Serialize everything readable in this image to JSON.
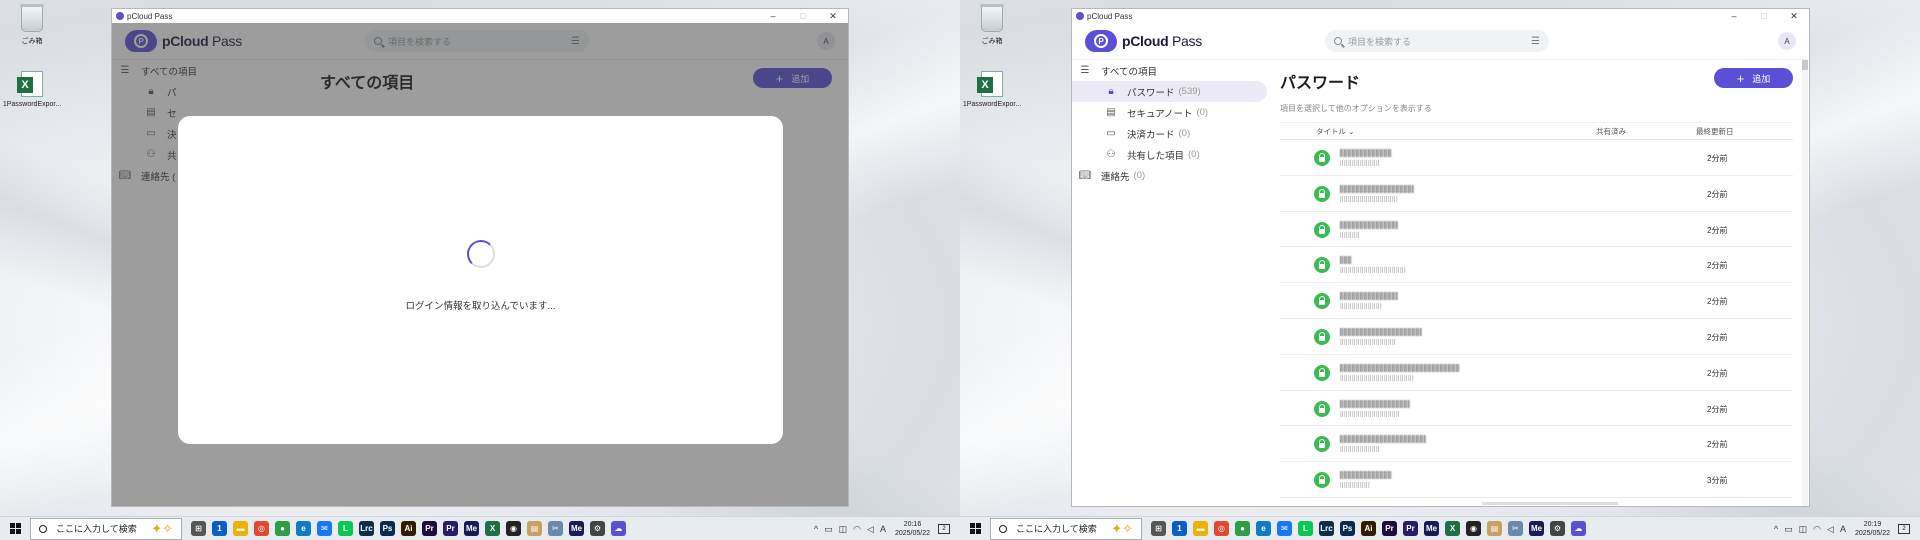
{
  "desktop": {
    "icons": [
      {
        "label": "ごみ箱",
        "icon": "recycle-bin-icon"
      },
      {
        "label": "1PasswordExpor...",
        "icon": "excel-file-icon"
      }
    ]
  },
  "window": {
    "title": "pCloud Pass",
    "controls": {
      "minimize": "–",
      "maximize": "□",
      "close": "✕"
    }
  },
  "app": {
    "logo_bold": "pCloud",
    "logo_light": " Pass",
    "search_placeholder": "項目を検索する",
    "avatar_initial": "A"
  },
  "left_screen": {
    "sidebar": [
      {
        "label": "すべての項目",
        "icon": "list-icon",
        "level": "top"
      },
      {
        "label": "パ",
        "icon": "lock-icon",
        "level": "sub"
      },
      {
        "label": "セ",
        "icon": "note-icon",
        "level": "sub"
      },
      {
        "label": "決",
        "icon": "card-icon",
        "level": "sub"
      },
      {
        "label": "共",
        "icon": "shared-icon",
        "level": "sub"
      },
      {
        "label": "連絡先 (",
        "icon": "book-icon",
        "level": "top"
      }
    ],
    "page_title": "すべての項目",
    "add_label": "追加",
    "loading_text": "ログイン情報を取り込んでいます..."
  },
  "right_screen": {
    "sidebar": [
      {
        "label": "すべての項目",
        "count": "",
        "icon": "list-icon",
        "level": "top"
      },
      {
        "label": "パスワード",
        "count": "(539)",
        "icon": "lock-icon",
        "level": "sub",
        "active": true
      },
      {
        "label": "セキュアノート",
        "count": "(0)",
        "icon": "note-icon",
        "level": "sub"
      },
      {
        "label": "決済カード",
        "count": "(0)",
        "icon": "card-icon",
        "level": "sub"
      },
      {
        "label": "共有した項目",
        "count": "(0)",
        "icon": "shared-icon",
        "level": "sub"
      },
      {
        "label": "連絡先",
        "count": "(0)",
        "icon": "book-icon",
        "level": "top"
      }
    ],
    "page_title": "パスワード",
    "add_label": "追加",
    "hint": "項目を選択して他のオプションを表示する",
    "columns": {
      "title": "タイトル ⌄",
      "shared": "共有済み",
      "updated": "最終更新日"
    },
    "rows": [
      {
        "time": "2分前",
        "w1": 52,
        "w2": 40
      },
      {
        "time": "2分前",
        "w1": 74,
        "w2": 58
      },
      {
        "time": "2分前",
        "w1": 58,
        "w2": 20
      },
      {
        "time": "2分前",
        "w1": 12,
        "w2": 66
      },
      {
        "time": "2分前",
        "w1": 58,
        "w2": 42
      },
      {
        "time": "2分前",
        "w1": 82,
        "w2": 56
      },
      {
        "time": "2分前",
        "w1": 120,
        "w2": 74
      },
      {
        "time": "2分前",
        "w1": 70,
        "w2": 60
      },
      {
        "time": "2分前",
        "w1": 86,
        "w2": 40
      },
      {
        "time": "3分前",
        "w1": 52,
        "w2": 30
      }
    ]
  },
  "taskbar": {
    "search_text": "ここに入力して検索",
    "left_clock": {
      "time": "20:16",
      "date": "2025/05/22"
    },
    "right_clock": {
      "time": "20:19",
      "date": "2025/05/22"
    },
    "ime": "A",
    "apps": [
      {
        "label": "⊞",
        "color": "#555555"
      },
      {
        "label": "1",
        "color": "#0a5fc2"
      },
      {
        "label": "▬",
        "color": "#e8b400"
      },
      {
        "label": "◎",
        "color": "#e04a2f"
      },
      {
        "label": "●",
        "color": "#2f9e44"
      },
      {
        "label": "e",
        "color": "#0f7bc4"
      },
      {
        "label": "✉",
        "color": "#1877f2"
      },
      {
        "label": "L",
        "color": "#06c755"
      },
      {
        "label": "Lrc",
        "color": "#0b2d4d"
      },
      {
        "label": "Ps",
        "color": "#0a2a4d"
      },
      {
        "label": "Ai",
        "color": "#331b00"
      },
      {
        "label": "Pr",
        "color": "#1e0a3c"
      },
      {
        "label": "Pr",
        "color": "#2a1a6a"
      },
      {
        "label": "Me",
        "color": "#1a1a5a"
      },
      {
        "label": "X",
        "color": "#1d7044"
      },
      {
        "label": "◉",
        "color": "#222222"
      },
      {
        "label": "▤",
        "color": "#c8a060"
      },
      {
        "label": "✂",
        "color": "#6a8aa8"
      },
      {
        "label": "Me",
        "color": "#1a1a5a"
      },
      {
        "label": "⚙",
        "color": "#444444"
      },
      {
        "label": "☁",
        "color": "#5b4fd6"
      }
    ]
  }
}
